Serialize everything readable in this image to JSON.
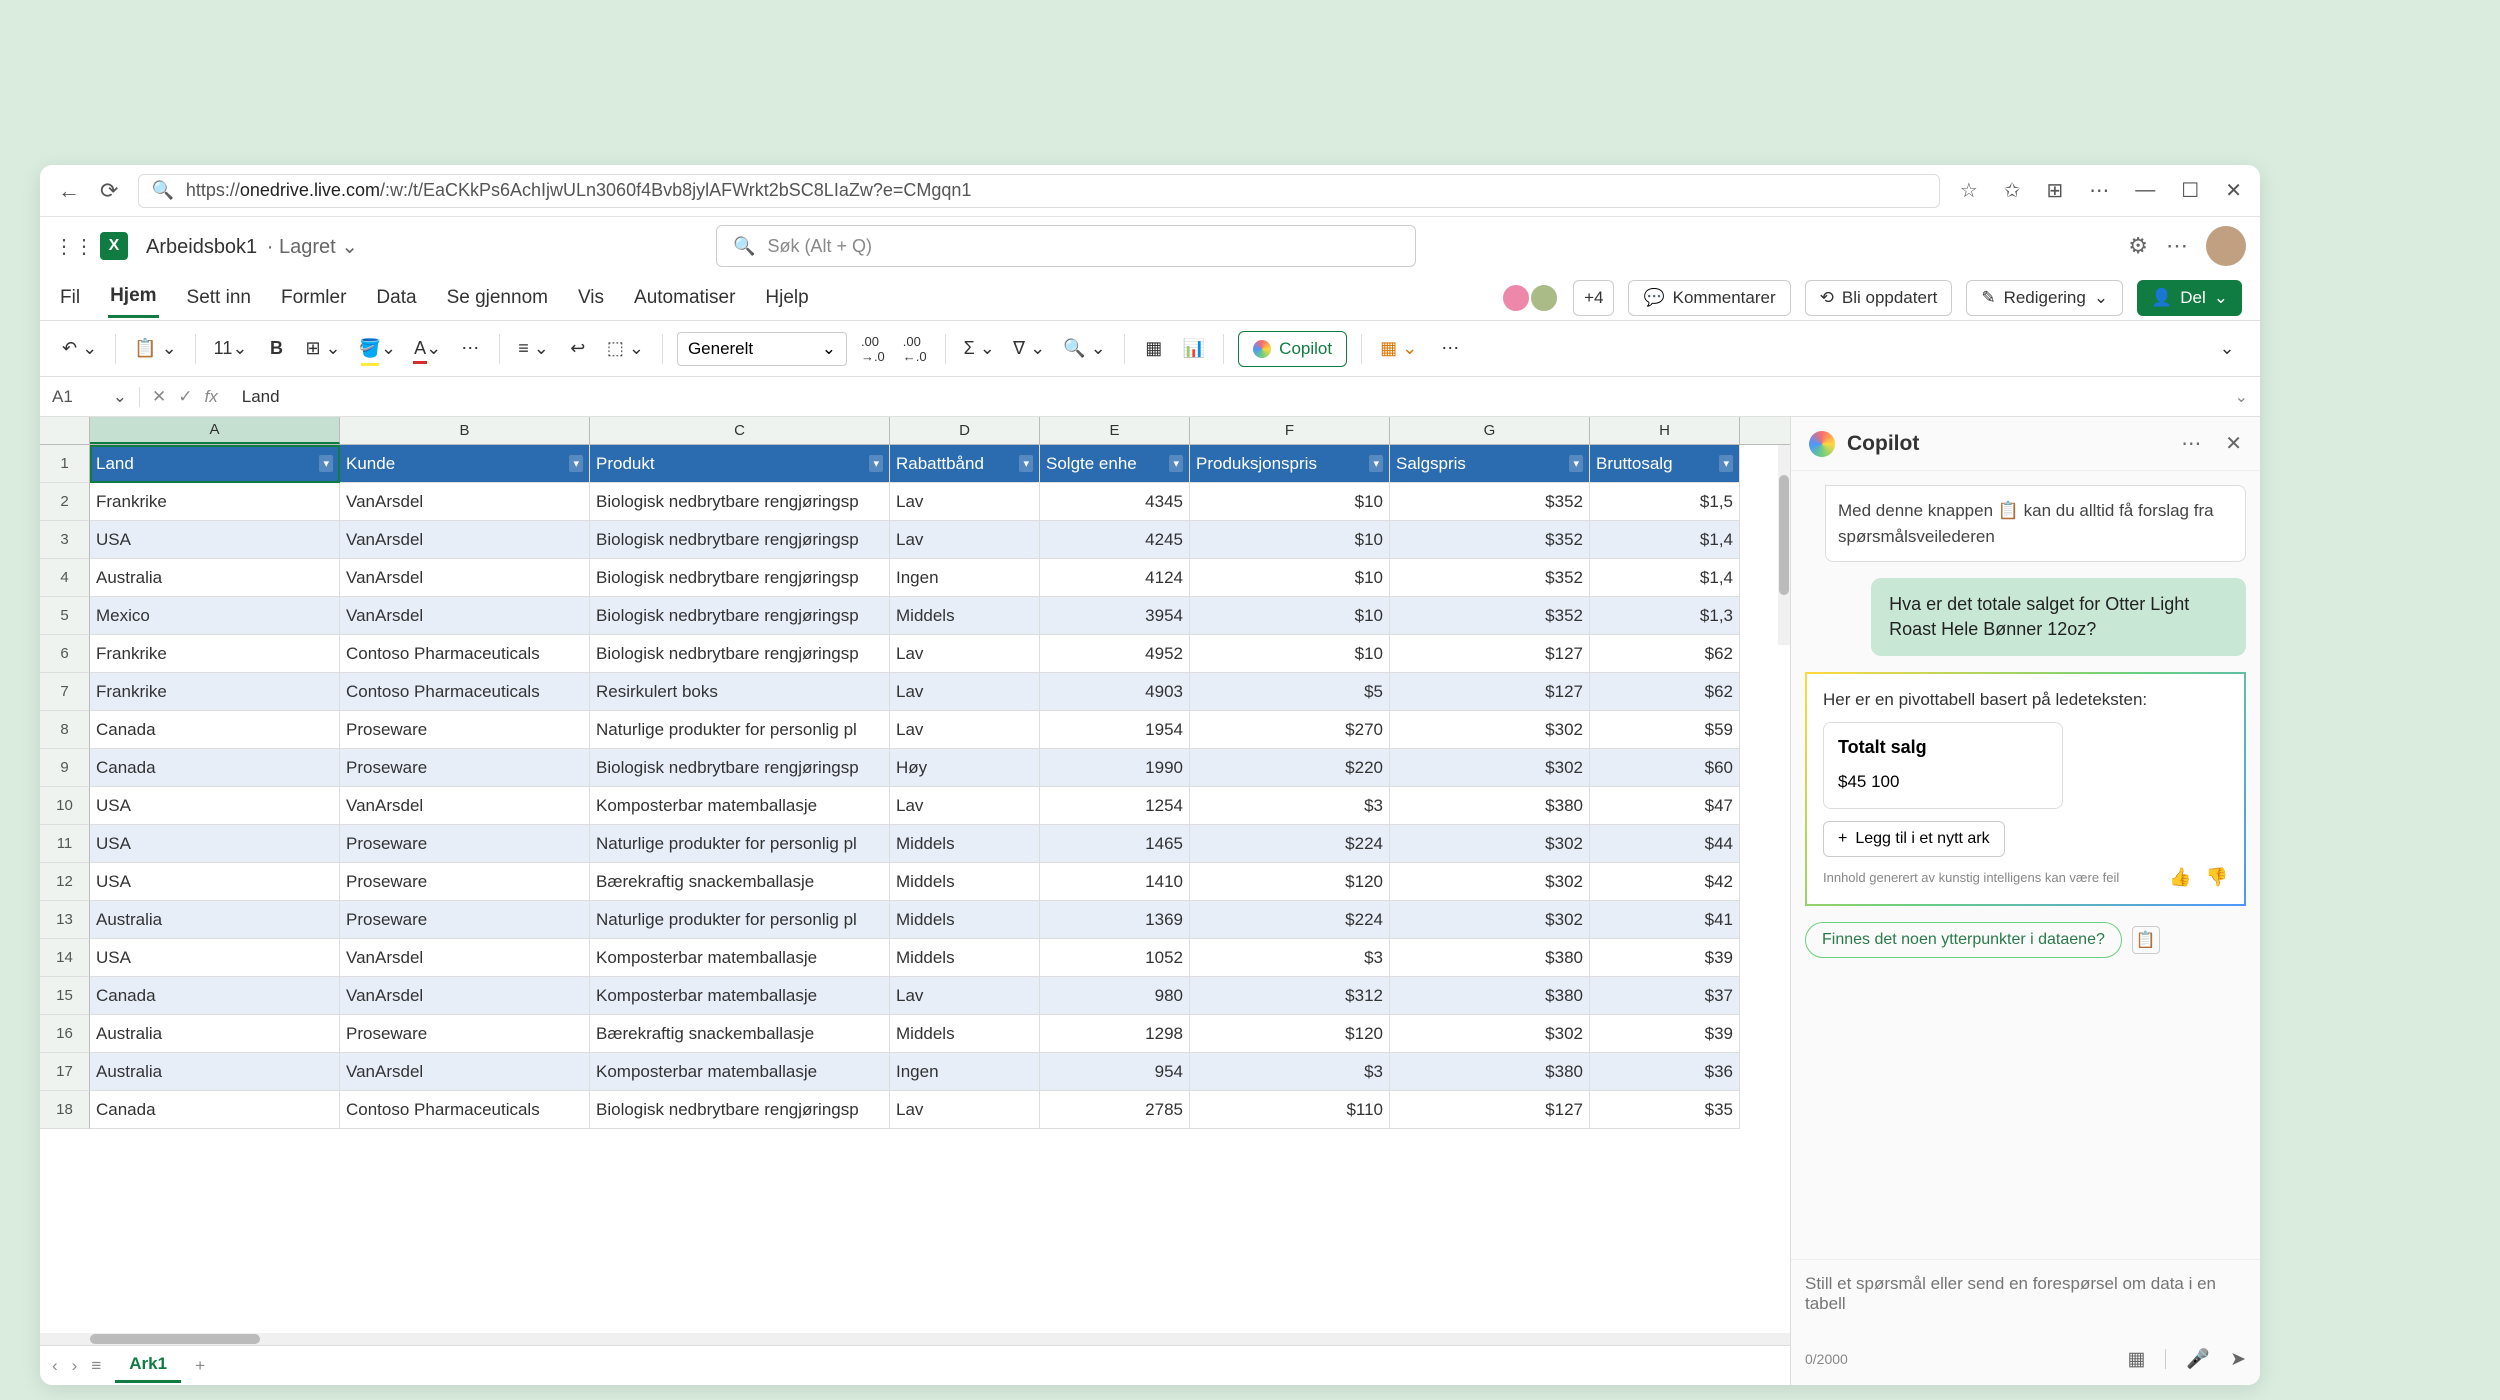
{
  "browser": {
    "url_host": "onedrive.live.com",
    "url_path": "/:w:/t/EaCKkPs6AchIjwULn3060f4Bvb8jylAFWrkt2bSC8LIaZw?e=CMgqn1"
  },
  "doc": {
    "title": "Arbeidsbok1",
    "status": "Lagret"
  },
  "search_placeholder": "Søk (Alt + Q)",
  "tabs": {
    "file": "Fil",
    "home": "Hjem",
    "insert": "Sett inn",
    "formulas": "Formler",
    "data": "Data",
    "review": "Se gjennom",
    "view": "Vis",
    "automate": "Automatiser",
    "help": "Hjelp"
  },
  "collab_count": "+4",
  "btns": {
    "comments": "Kommentarer",
    "uptodate": "Bli oppdatert",
    "editing": "Redigering",
    "share": "Del"
  },
  "toolbar": {
    "font_size": "11",
    "number_format": "Generelt",
    "copilot": "Copilot"
  },
  "formula": {
    "name_box": "A1",
    "value": "Land"
  },
  "columns": [
    "A",
    "B",
    "C",
    "D",
    "E",
    "F",
    "G",
    "H"
  ],
  "headers": [
    "Land",
    "Kunde",
    "Produkt",
    "Rabattbånd",
    "Solgte enhe",
    "Produksjonspris",
    "Salgspris",
    "Bruttosalg"
  ],
  "rows": [
    {
      "n": 2,
      "c": [
        "Frankrike",
        "VanArsdel",
        "Biologisk nedbrytbare rengjøringsp",
        "Lav",
        "4345",
        "$10",
        "$352",
        "$1,5"
      ]
    },
    {
      "n": 3,
      "c": [
        "USA",
        "VanArsdel",
        "Biologisk nedbrytbare rengjøringsp",
        "Lav",
        "4245",
        "$10",
        "$352",
        "$1,4"
      ]
    },
    {
      "n": 4,
      "c": [
        "Australia",
        "VanArsdel",
        "Biologisk nedbrytbare rengjøringsp",
        "Ingen",
        "4124",
        "$10",
        "$352",
        "$1,4"
      ]
    },
    {
      "n": 5,
      "c": [
        "Mexico",
        "VanArsdel",
        "Biologisk nedbrytbare rengjøringsp",
        "Middels",
        "3954",
        "$10",
        "$352",
        "$1,3"
      ]
    },
    {
      "n": 6,
      "c": [
        "Frankrike",
        "Contoso Pharmaceuticals",
        "Biologisk nedbrytbare rengjøringsp",
        "Lav",
        "4952",
        "$10",
        "$127",
        "$62"
      ]
    },
    {
      "n": 7,
      "c": [
        "Frankrike",
        "Contoso Pharmaceuticals",
        "Resirkulert boks",
        "Lav",
        "4903",
        "$5",
        "$127",
        "$62"
      ]
    },
    {
      "n": 8,
      "c": [
        "Canada",
        "Proseware",
        "Naturlige produkter for personlig pl",
        "Lav",
        "1954",
        "$270",
        "$302",
        "$59"
      ]
    },
    {
      "n": 9,
      "c": [
        "Canada",
        "Proseware",
        "Biologisk nedbrytbare rengjøringsp",
        "Høy",
        "1990",
        "$220",
        "$302",
        "$60"
      ]
    },
    {
      "n": 10,
      "c": [
        "USA",
        "VanArsdel",
        "Komposterbar matemballasje",
        "Lav",
        "1254",
        "$3",
        "$380",
        "$47"
      ]
    },
    {
      "n": 11,
      "c": [
        "USA",
        "Proseware",
        "Naturlige produkter for personlig pl",
        "Middels",
        "1465",
        "$224",
        "$302",
        "$44"
      ]
    },
    {
      "n": 12,
      "c": [
        "USA",
        "Proseware",
        "Bærekraftig snackemballasje",
        "Middels",
        "1410",
        "$120",
        "$302",
        "$42"
      ]
    },
    {
      "n": 13,
      "c": [
        "Australia",
        "Proseware",
        "Naturlige produkter for personlig pl",
        "Middels",
        "1369",
        "$224",
        "$302",
        "$41"
      ]
    },
    {
      "n": 14,
      "c": [
        "USA",
        "VanArsdel",
        "Komposterbar matemballasje",
        "Middels",
        "1052",
        "$3",
        "$380",
        "$39"
      ]
    },
    {
      "n": 15,
      "c": [
        "Canada",
        "VanArsdel",
        "Komposterbar matemballasje",
        "Lav",
        "980",
        "$312",
        "$380",
        "$37"
      ]
    },
    {
      "n": 16,
      "c": [
        "Australia",
        "Proseware",
        "Bærekraftig snackemballasje",
        "Middels",
        "1298",
        "$120",
        "$302",
        "$39"
      ]
    },
    {
      "n": 17,
      "c": [
        "Australia",
        "VanArsdel",
        "Komposterbar matemballasje",
        "Ingen",
        "954",
        "$3",
        "$380",
        "$36"
      ]
    },
    {
      "n": 18,
      "c": [
        "Canada",
        "Contoso Pharmaceuticals",
        "Biologisk nedbrytbare rengjøringsp",
        "Lav",
        "2785",
        "$110",
        "$127",
        "$35"
      ]
    }
  ],
  "sheet_tab": "Ark1",
  "copilot": {
    "title": "Copilot",
    "hint": "Med denne knappen 📋 kan du alltid få forslag fra spørsmålsveilederen",
    "user_msg": "Hva er det totale salget for Otter Light Roast Hele Bønner 12oz?",
    "response_intro": "Her er en pivottabell basert på ledeteksten:",
    "pivot_title": "Totalt salg",
    "pivot_value": "$45 100",
    "add_action": "Legg til i et nytt ark",
    "disclaimer": "Innhold generert av kunstig intelligens kan være feil",
    "suggestion": "Finnes det noen ytterpunkter i dataene?",
    "input_placeholder": "Still et spørsmål eller send en forespørsel om data i en tabell",
    "counter": "0/2000"
  }
}
